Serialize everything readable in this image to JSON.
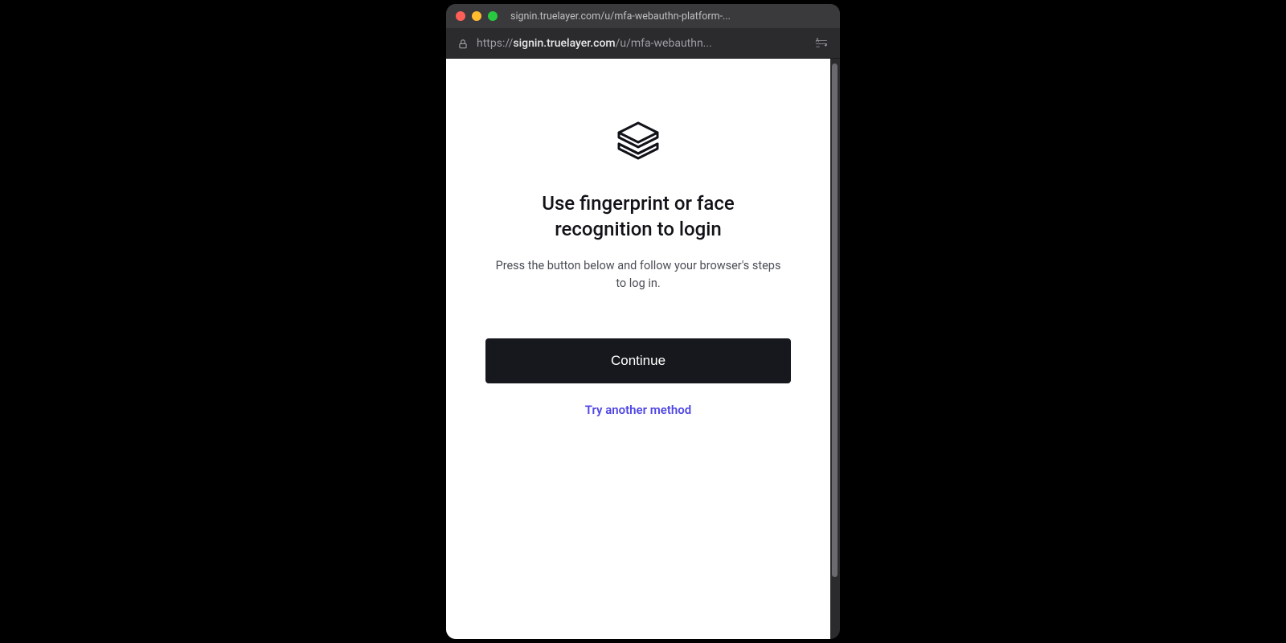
{
  "window": {
    "tab_title": "signin.truelayer.com/u/mfa-webauthn-platform-...",
    "url_prefix": "https://",
    "url_host": "signin.truelayer.com",
    "url_path": "/u/mfa-webauthn..."
  },
  "page": {
    "logo_alt": "layers-icon",
    "heading": "Use fingerprint or face recognition to login",
    "subtext": "Press the button below and follow your browser's steps to log in.",
    "continue_label": "Continue",
    "alt_method_label": "Try another method"
  },
  "colors": {
    "accent_link": "#4f46e5",
    "button_bg": "#16181d"
  }
}
